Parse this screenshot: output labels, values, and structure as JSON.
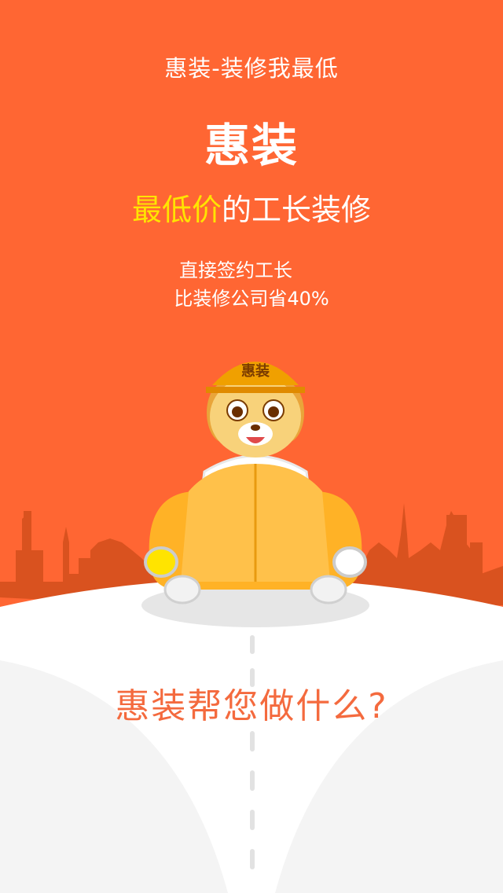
{
  "colors": {
    "primary": "#FF6633",
    "highlight": "#FFE400",
    "white": "#FFFFFF",
    "bottom_bg": "#F4F4F4",
    "question": "#F46A3E",
    "skyline": "#D9521F"
  },
  "hero": {
    "tagline": "惠装-装修我最低",
    "brand": "惠装",
    "headline_highlight": "最低价",
    "headline_rest": "的工长装修",
    "subline1": "直接签约工长",
    "subline2": "比装修公司省40%"
  },
  "mascot": {
    "icon": "dog-driving-car-icon",
    "hat_label": "惠装"
  },
  "bottom": {
    "question": "惠装帮您做什么?"
  }
}
